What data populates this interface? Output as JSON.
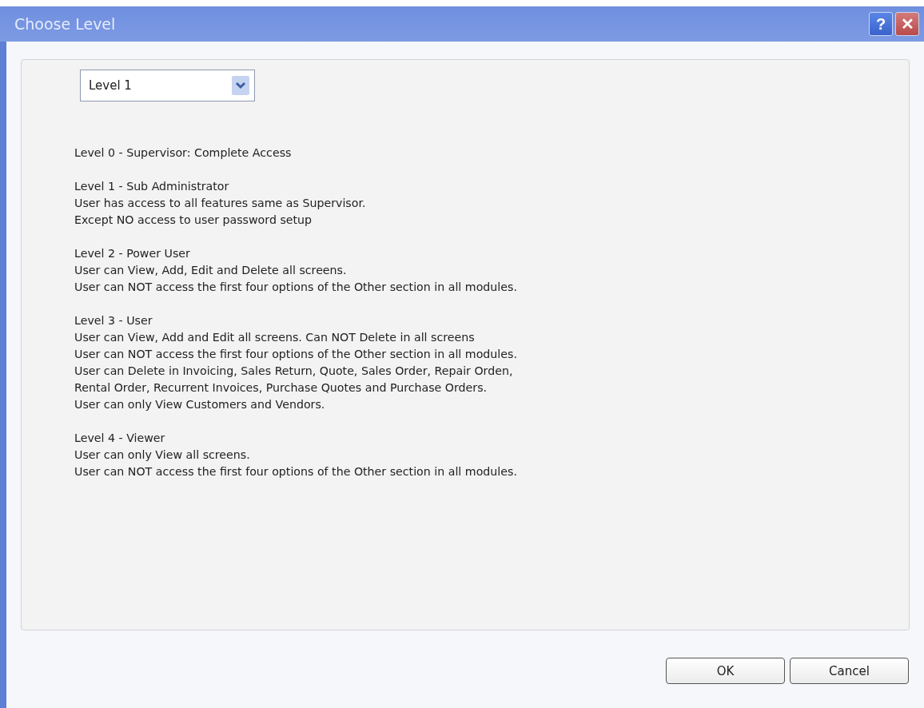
{
  "window": {
    "title": "Choose Level",
    "title_buttons": [
      {
        "kind": "help",
        "label": "?"
      },
      {
        "kind": "close",
        "label": "✕"
      }
    ]
  },
  "level_select": {
    "value": "Level 1"
  },
  "descriptions": [
    {
      "lines": [
        "Level 0 - Supervisor: Complete Access"
      ]
    },
    {
      "lines": [
        "Level 1 - Sub Administrator",
        "User has access to all features same as Supervisor.",
        "Except NO access to user password setup"
      ]
    },
    {
      "lines": [
        "Level 2 - Power User",
        "User can View, Add, Edit and Delete all screens.",
        "User can NOT access the first four options of the Other section in all modules."
      ]
    },
    {
      "lines": [
        "Level 3 - User",
        "User can View, Add and Edit all screens. Can NOT Delete in all screens",
        "User can NOT access the first four options of the Other section in all modules.",
        "User can Delete in Invoicing, Sales Return, Quote, Sales Order, Repair Orden,",
        "Rental Order, Recurrent Invoices, Purchase Quotes and Purchase Orders.",
        "User can only View Customers and Vendors."
      ]
    },
    {
      "lines": [
        "Level 4 - Viewer",
        "User can only View all screens.",
        "User can NOT access the first four options of the Other section in all modules."
      ]
    }
  ],
  "buttons": [
    "OK",
    "Cancel"
  ]
}
